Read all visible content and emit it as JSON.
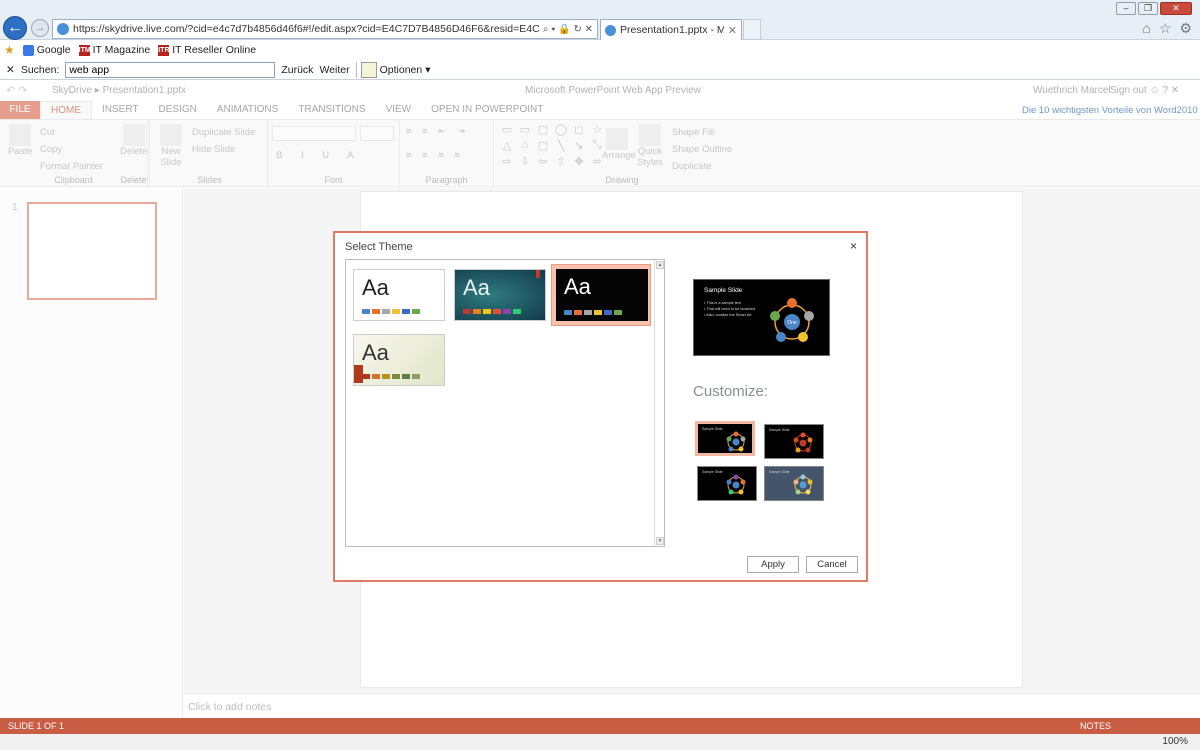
{
  "browser": {
    "url": "https://skydrive.live.com/?cid=e4c7d7b4856d46f6#!/edit.aspx?cid=E4C7D7B4856D46F6&resid=E4C7D7B4856D46F6%21130&",
    "tab_title": "Presentation1.pptx - Micro...",
    "favorites": [
      "Google",
      "IT Magazine",
      "IT Reseller Online"
    ],
    "find_label": "Suchen:",
    "find_value": "web app",
    "find_prev": "Zurück",
    "find_next": "Weiter",
    "find_options": "Optionen"
  },
  "app": {
    "breadcrumb": [
      "SkyDrive",
      "Presentation1.pptx"
    ],
    "title": "Microsoft PowerPoint Web App Preview",
    "user": "Wuethrich Marcel",
    "signout": "Sign out",
    "promo_link": "Die 10 wichtigsten Vorteile von Word2010",
    "tabs": [
      "FILE",
      "HOME",
      "INSERT",
      "DESIGN",
      "ANIMATIONS",
      "TRANSITIONS",
      "VIEW",
      "OPEN IN POWERPOINT"
    ],
    "ribbon": {
      "paste": "Paste",
      "cut": "Cut",
      "copy": "Copy",
      "format_painter": "Format Painter",
      "clipboard": "Clipboard",
      "delete_btn": "Delete",
      "delete_grp": "Delete",
      "new_slide": "New Slide",
      "duplicate_slide": "Duplicate Slide",
      "hide_slide": "Hide Slide",
      "slides": "Slides",
      "font": "Font",
      "paragraph": "Paragraph",
      "arrange": "Arrange",
      "quick_styles": "Quick Styles",
      "shape_fill": "Shape Fill",
      "shape_outline": "Shape Outline",
      "duplicate": "Duplicate",
      "drawing": "Drawing"
    },
    "slide_number": "1",
    "notes_placeholder": "Click to add notes",
    "status": "SLIDE 1 OF 1",
    "status_notes": "NOTES",
    "zoom": "100%"
  },
  "dialog": {
    "title": "Select Theme",
    "close": "×",
    "themes": [
      {
        "label": "Aa",
        "style": "white",
        "swatches": [
          "#4a86c5",
          "#e8712d",
          "#a6a6a6",
          "#f2c12e",
          "#3b6cc1",
          "#6aa84f"
        ]
      },
      {
        "label": "Aa",
        "style": "teal",
        "swatches": [
          "#c0392b",
          "#e67e22",
          "#f1c40f",
          "#e74c3c",
          "#8e44ad",
          "#2ecc71"
        ]
      },
      {
        "label": "Aa",
        "style": "black",
        "selected": true,
        "swatches": [
          "#4a86c5",
          "#e8712d",
          "#a6a6a6",
          "#f2c12e",
          "#3b6cc1",
          "#6aa84f"
        ]
      },
      {
        "label": "Aa",
        "style": "cream",
        "swatches": [
          "#b03a1e",
          "#d4732e",
          "#b8941f",
          "#7a8b3a",
          "#5f7a49",
          "#8f9a69"
        ]
      }
    ],
    "sample": {
      "title": "Sample Slide",
      "bullets": [
        "This is a sample text",
        "That will need to be localized",
        "Also, localize the Smart Art"
      ],
      "center_label": "One"
    },
    "customize": "Customize:",
    "variants": [
      "Sample Slide",
      "Sample Slide",
      "Sample Slide",
      "Sample Slide"
    ],
    "apply": "Apply",
    "cancel": "Cancel"
  },
  "colors": {
    "accent": "#e07b63",
    "status_bar": "#c85d44"
  }
}
